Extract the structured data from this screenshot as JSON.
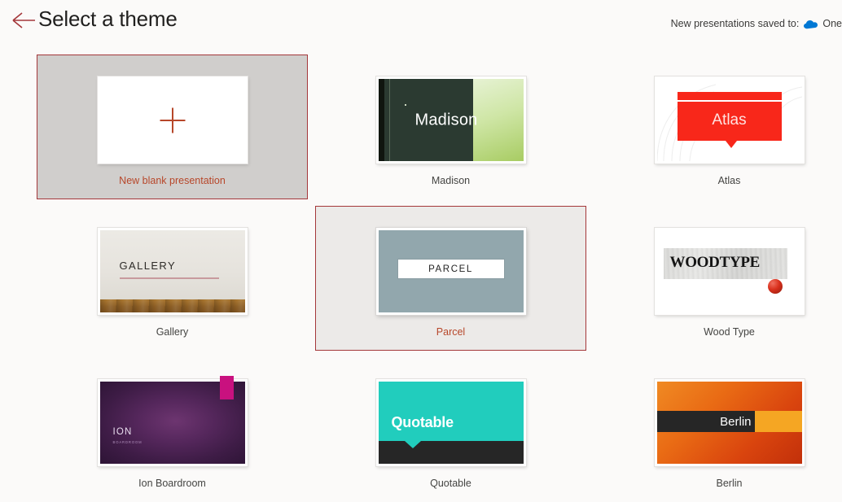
{
  "header": {
    "title": "Select a theme",
    "back_icon": "back-arrow-icon",
    "saved_to_label": "New presentations saved to:",
    "cloud_icon": "onedrive-cloud-icon",
    "saved_to_value": "One",
    "accent_color": "#b7472a",
    "cloud_color": "#0078d4"
  },
  "themes": [
    {
      "name": "New blank presentation",
      "state": "hover",
      "thumb": {
        "kind": "blank",
        "plus_icon": "plus-icon",
        "plus_color": "#b7472a",
        "background": "#ffffff"
      }
    },
    {
      "name": "Madison",
      "state": "normal",
      "thumb": {
        "kind": "madison",
        "title": "Madison",
        "background": "#2b3a31",
        "accent": "#a8cc63"
      }
    },
    {
      "name": "Atlas",
      "state": "normal",
      "thumb": {
        "kind": "atlas",
        "title": "Atlas",
        "background": "#ffffff",
        "accent": "#f8271a"
      }
    },
    {
      "name": "Gallery",
      "state": "normal",
      "thumb": {
        "kind": "gallery",
        "title": "GALLERY",
        "background": "#e9e6e1",
        "accent": "#c89a9e"
      }
    },
    {
      "name": "Parcel",
      "state": "selected",
      "thumb": {
        "kind": "parcel",
        "title": "PARCEL",
        "background": "#92a7ad",
        "accent": "#ffffff"
      }
    },
    {
      "name": "Wood Type",
      "state": "normal",
      "thumb": {
        "kind": "woodtype",
        "title": "WOODTYPE",
        "background": "#ffffff",
        "accent": "#d9301c"
      }
    },
    {
      "name": "Ion Boardroom",
      "state": "normal",
      "thumb": {
        "kind": "ion",
        "title": "ION",
        "subtitle": "BOARDROOM",
        "background": "#55275c",
        "accent": "#c9117f"
      }
    },
    {
      "name": "Quotable",
      "state": "normal",
      "thumb": {
        "kind": "quotable",
        "title": "Quotable",
        "background": "#21cdbd",
        "accent": "#262626"
      }
    },
    {
      "name": "Berlin",
      "state": "normal",
      "thumb": {
        "kind": "berlin",
        "title": "Berlin",
        "background": "#e96a14",
        "accent": "#f5a623"
      }
    }
  ]
}
